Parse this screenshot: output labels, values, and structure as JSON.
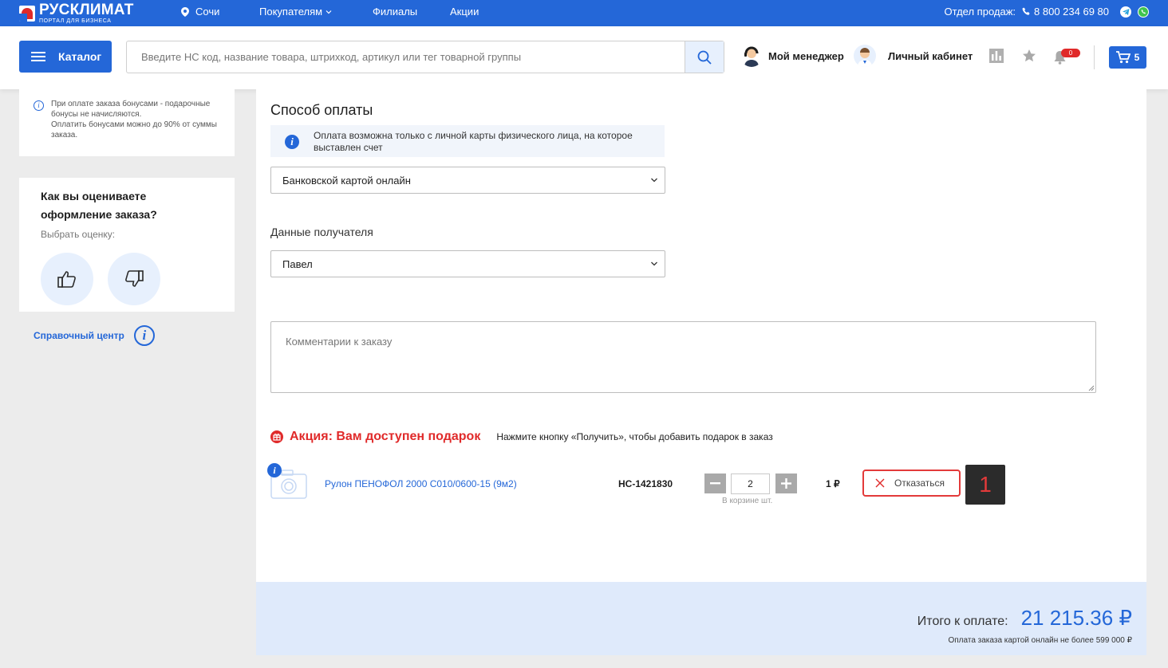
{
  "topbar": {
    "logo_name": "РУСКЛИМАТ",
    "logo_sub": "ПОРТАЛ ДЛЯ БИЗНЕСА",
    "city": "Сочи",
    "nav": [
      "Покупателям",
      "Филиалы",
      "Акции"
    ],
    "sales_label": "Отдел продаж:",
    "sales_phone": "8 800 234 69 80"
  },
  "header": {
    "catalog_label": "Каталог",
    "search_placeholder": "Введите НС код, название товара, штрихкод, артикул или тег товарной группы",
    "manager_label": "Мой менеджер",
    "account_label": "Личный кабинет",
    "notifications_count": "0",
    "cart_count": "5"
  },
  "sidebar": {
    "bonus_note_1": "При оплате заказа бонусами - подарочные бонусы не начисляются.",
    "bonus_note_2": "Оплатить бонусами можно до 90% от суммы заказа.",
    "rate_title": "Как вы оцениваете оформление заказа?",
    "rate_sub": "Выбрать оценку:",
    "help_label": "Справочный центр"
  },
  "payment": {
    "title": "Способ оплаты",
    "info": "Оплата возможна только с личной карты физического лица, на которое выставлен счет",
    "method": "Банковской картой онлайн",
    "recipient_label": "Данные получателя",
    "recipient": "Павел",
    "comment_placeholder": "Комментарии к заказу"
  },
  "promo": {
    "title": "Акция: Вам доступен подарок",
    "hint": "Нажмите кнопку «Получить», чтобы добавить подарок в заказ",
    "product": {
      "name": "Рулон ПЕНОФОЛ 2000 С010/0600-15 (9м2)",
      "code": "НС-1421830",
      "qty": "2",
      "qty_note": "В корзине шт.",
      "price": "1 ₽",
      "refuse_label": "Отказаться"
    },
    "step_badge": "1"
  },
  "total": {
    "label": "Итого к оплате:",
    "value": "21 215.36 ₽",
    "note": "Оплата заказа картой онлайн не более 599 000 ₽"
  },
  "colors": {
    "brand_blue": "#2467d8",
    "accent_red": "#e02a2a"
  }
}
